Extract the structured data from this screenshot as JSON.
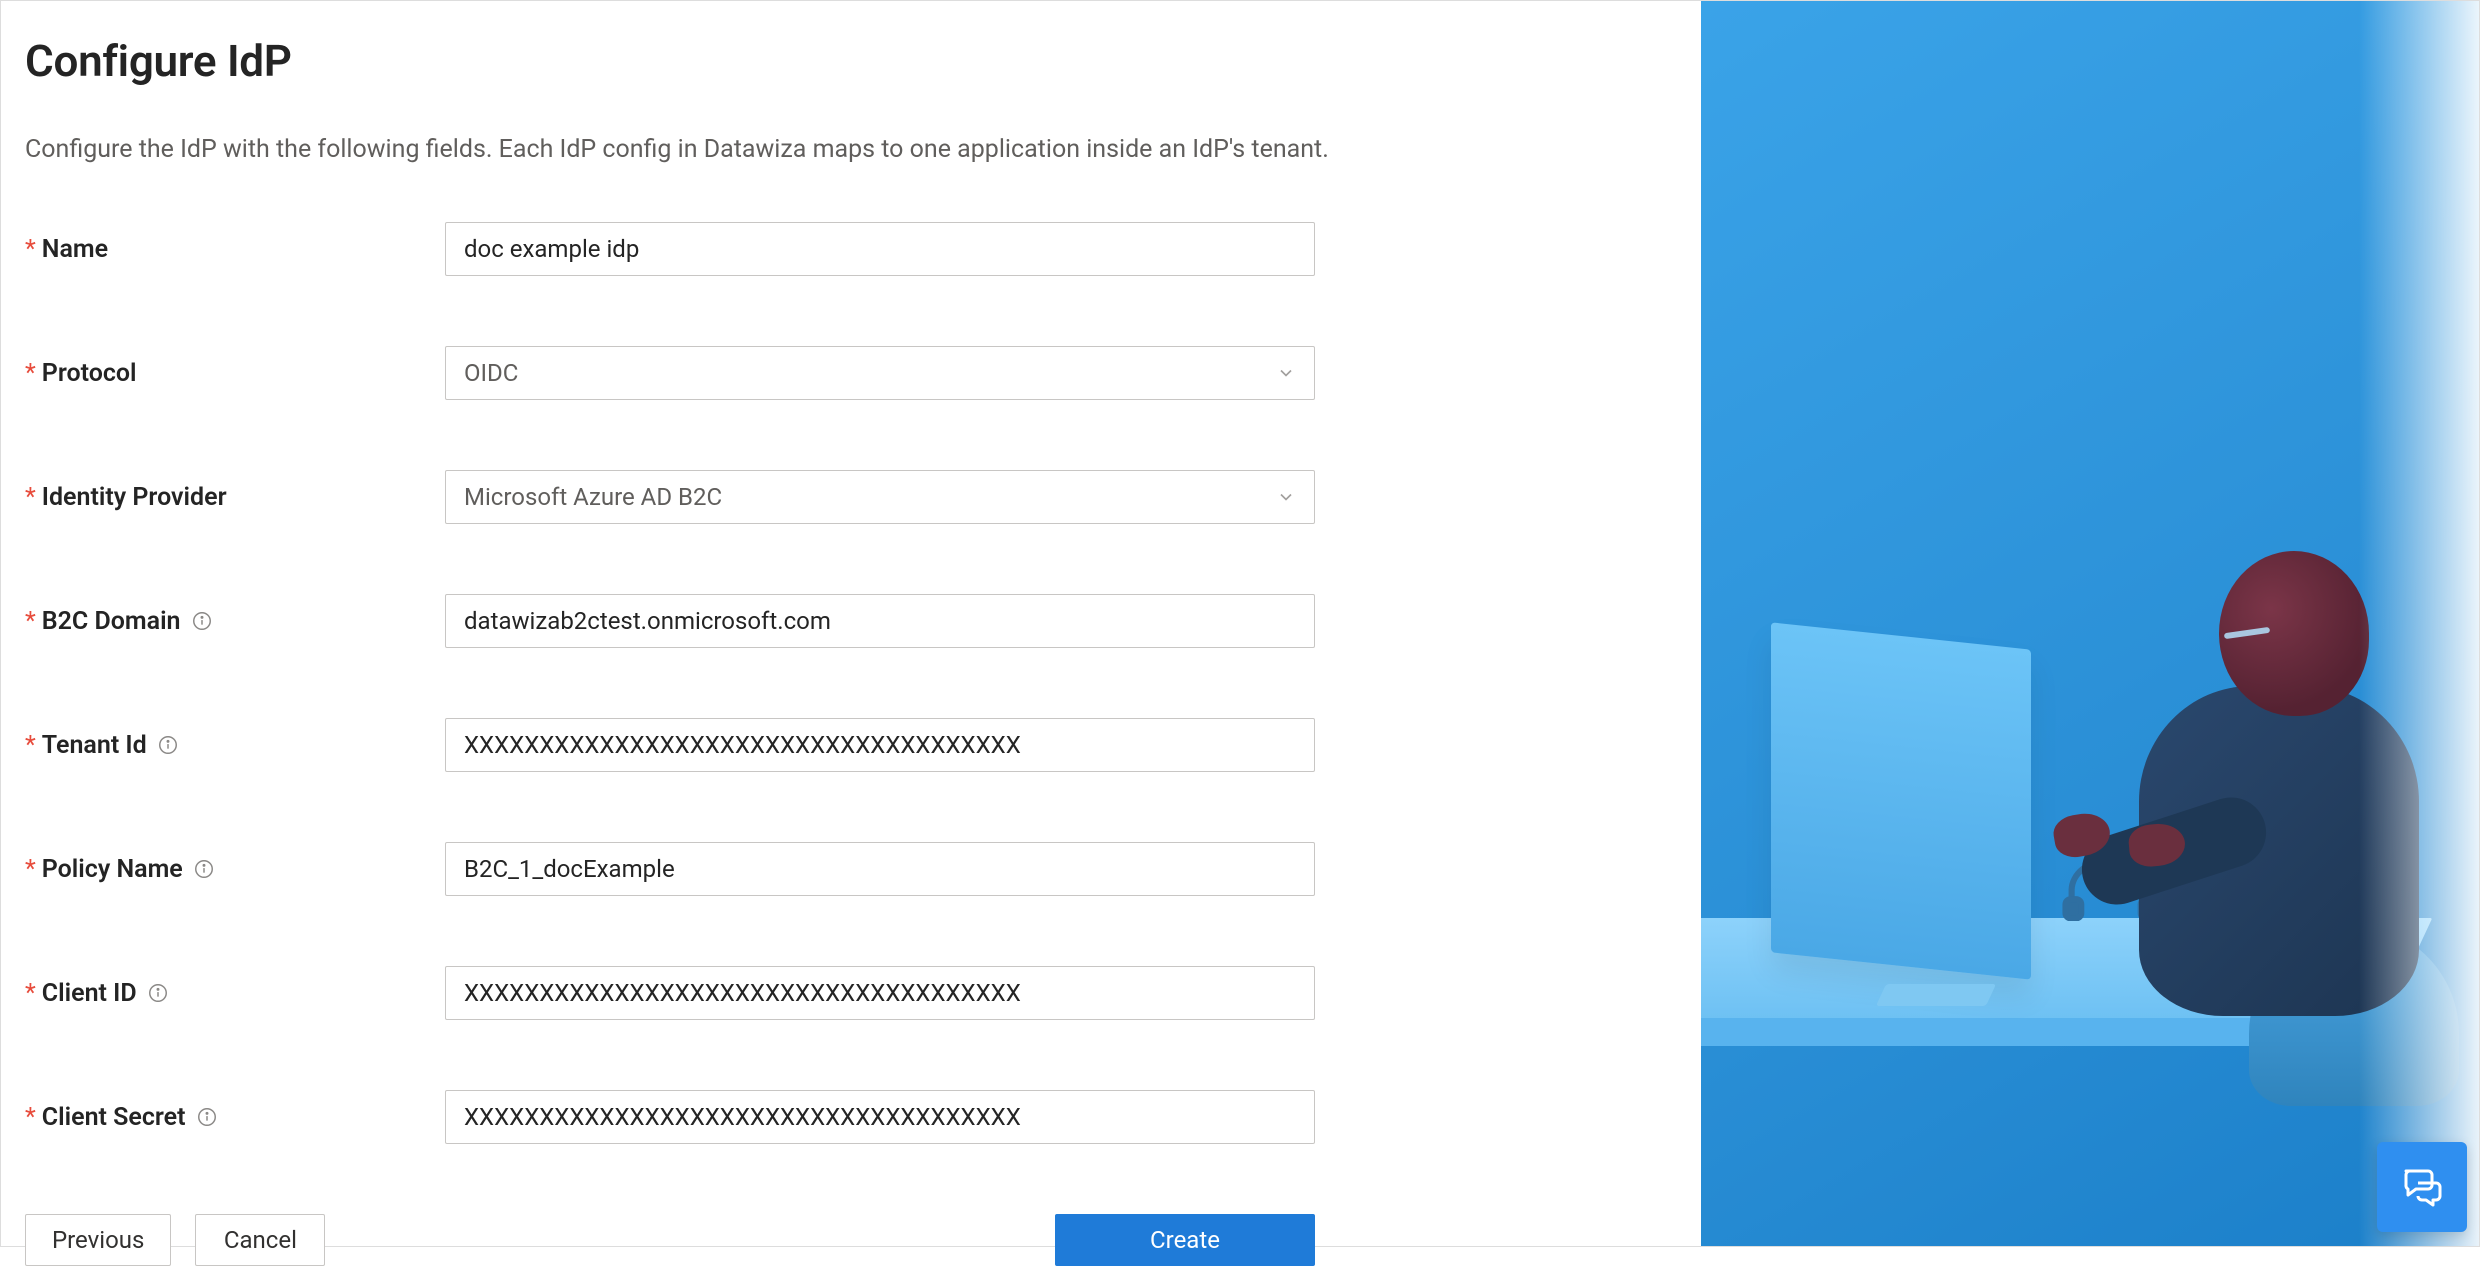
{
  "page": {
    "title": "Configure IdP",
    "description": "Configure the IdP with the following fields. Each IdP config in Datawiza maps to one application inside an IdP's tenant."
  },
  "fields": {
    "name": {
      "label": "Name",
      "value": "doc example idp"
    },
    "protocol": {
      "label": "Protocol",
      "value": "OIDC"
    },
    "identity_provider": {
      "label": "Identity Provider",
      "value": "Microsoft Azure AD B2C"
    },
    "b2c_domain": {
      "label": "B2C Domain",
      "value": "datawizab2ctest.onmicrosoft.com"
    },
    "tenant_id": {
      "label": "Tenant Id",
      "value": "XXXXXXXXXXXXXXXXXXXXXXXXXXXXXXXXXXXXX"
    },
    "policy_name": {
      "label": "Policy Name",
      "value": "B2C_1_docExample"
    },
    "client_id": {
      "label": "Client ID",
      "value": "XXXXXXXXXXXXXXXXXXXXXXXXXXXXXXXXXXXXX"
    },
    "client_secret": {
      "label": "Client Secret",
      "value": "XXXXXXXXXXXXXXXXXXXXXXXXXXXXXXXXXXXXX"
    }
  },
  "buttons": {
    "previous": "Previous",
    "cancel": "Cancel",
    "create": "Create"
  },
  "icons": {
    "info": "info-circle-icon",
    "chevron": "chevron-down-icon",
    "chat": "chat-bubbles-icon"
  },
  "colors": {
    "primary": "#1f7bd8",
    "required": "#e74c3c",
    "illustration_bg": "#2a8fd6"
  }
}
